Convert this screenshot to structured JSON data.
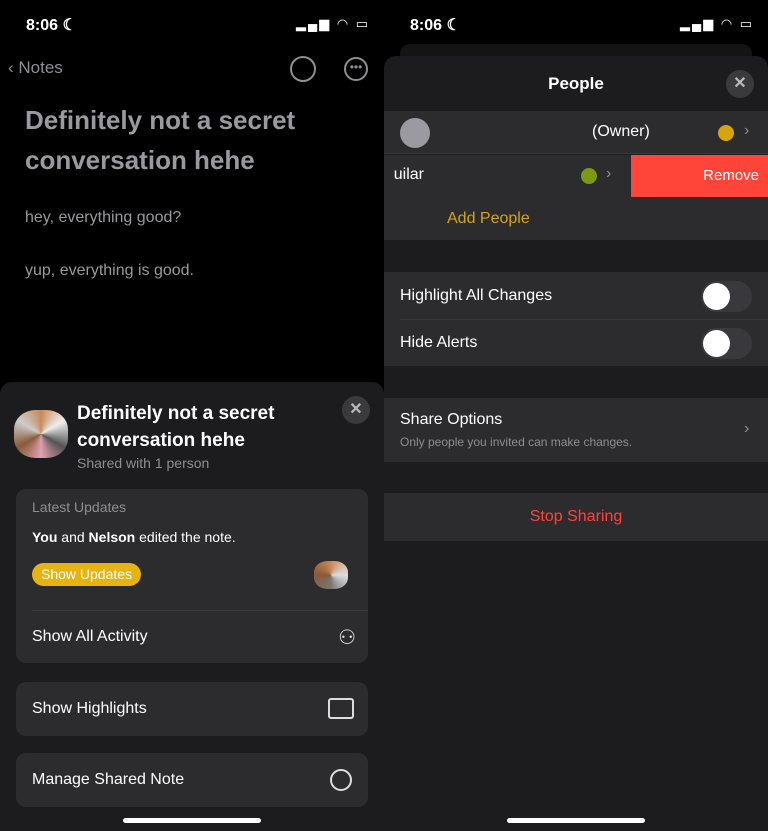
{
  "left": {
    "status": {
      "time": "8:06 ☾"
    },
    "nav": {
      "back_label": "Notes"
    },
    "note": {
      "title": "Definitely not a secret conversation hehe",
      "lines": [
        "hey, everything good?",
        "yup, everything is good."
      ]
    },
    "sheet": {
      "title": "Definitely not a secret conversation hehe",
      "subtitle": "Shared with 1 person",
      "latest": {
        "heading": "Latest Updates",
        "you": "You",
        "and": " and ",
        "name": "Nelson",
        "rest": " edited the note.",
        "button": "Show Updates"
      },
      "show_all_activity": "Show All Activity",
      "show_highlights": "Show Highlights",
      "manage": "Manage Shared Note"
    }
  },
  "right": {
    "status": {
      "time": "8:06 ☾"
    },
    "title": "People",
    "owner": {
      "label": "(Owner)",
      "dot_color": "#d4a60c"
    },
    "member": {
      "name_fragment": "uilar",
      "dot_color": "#7a9a14",
      "remove": "Remove"
    },
    "add_people": "Add People",
    "highlight_all": {
      "label": "Highlight All Changes",
      "on": false
    },
    "hide_alerts": {
      "label": "Hide Alerts",
      "on": false
    },
    "share_options": {
      "label": "Share Options",
      "sub": "Only people you invited can make changes."
    },
    "stop_sharing": "Stop Sharing"
  },
  "colors": {
    "accent": "#f5c518",
    "destructive": "#ff453a",
    "remove_bg": "#ff453a"
  }
}
